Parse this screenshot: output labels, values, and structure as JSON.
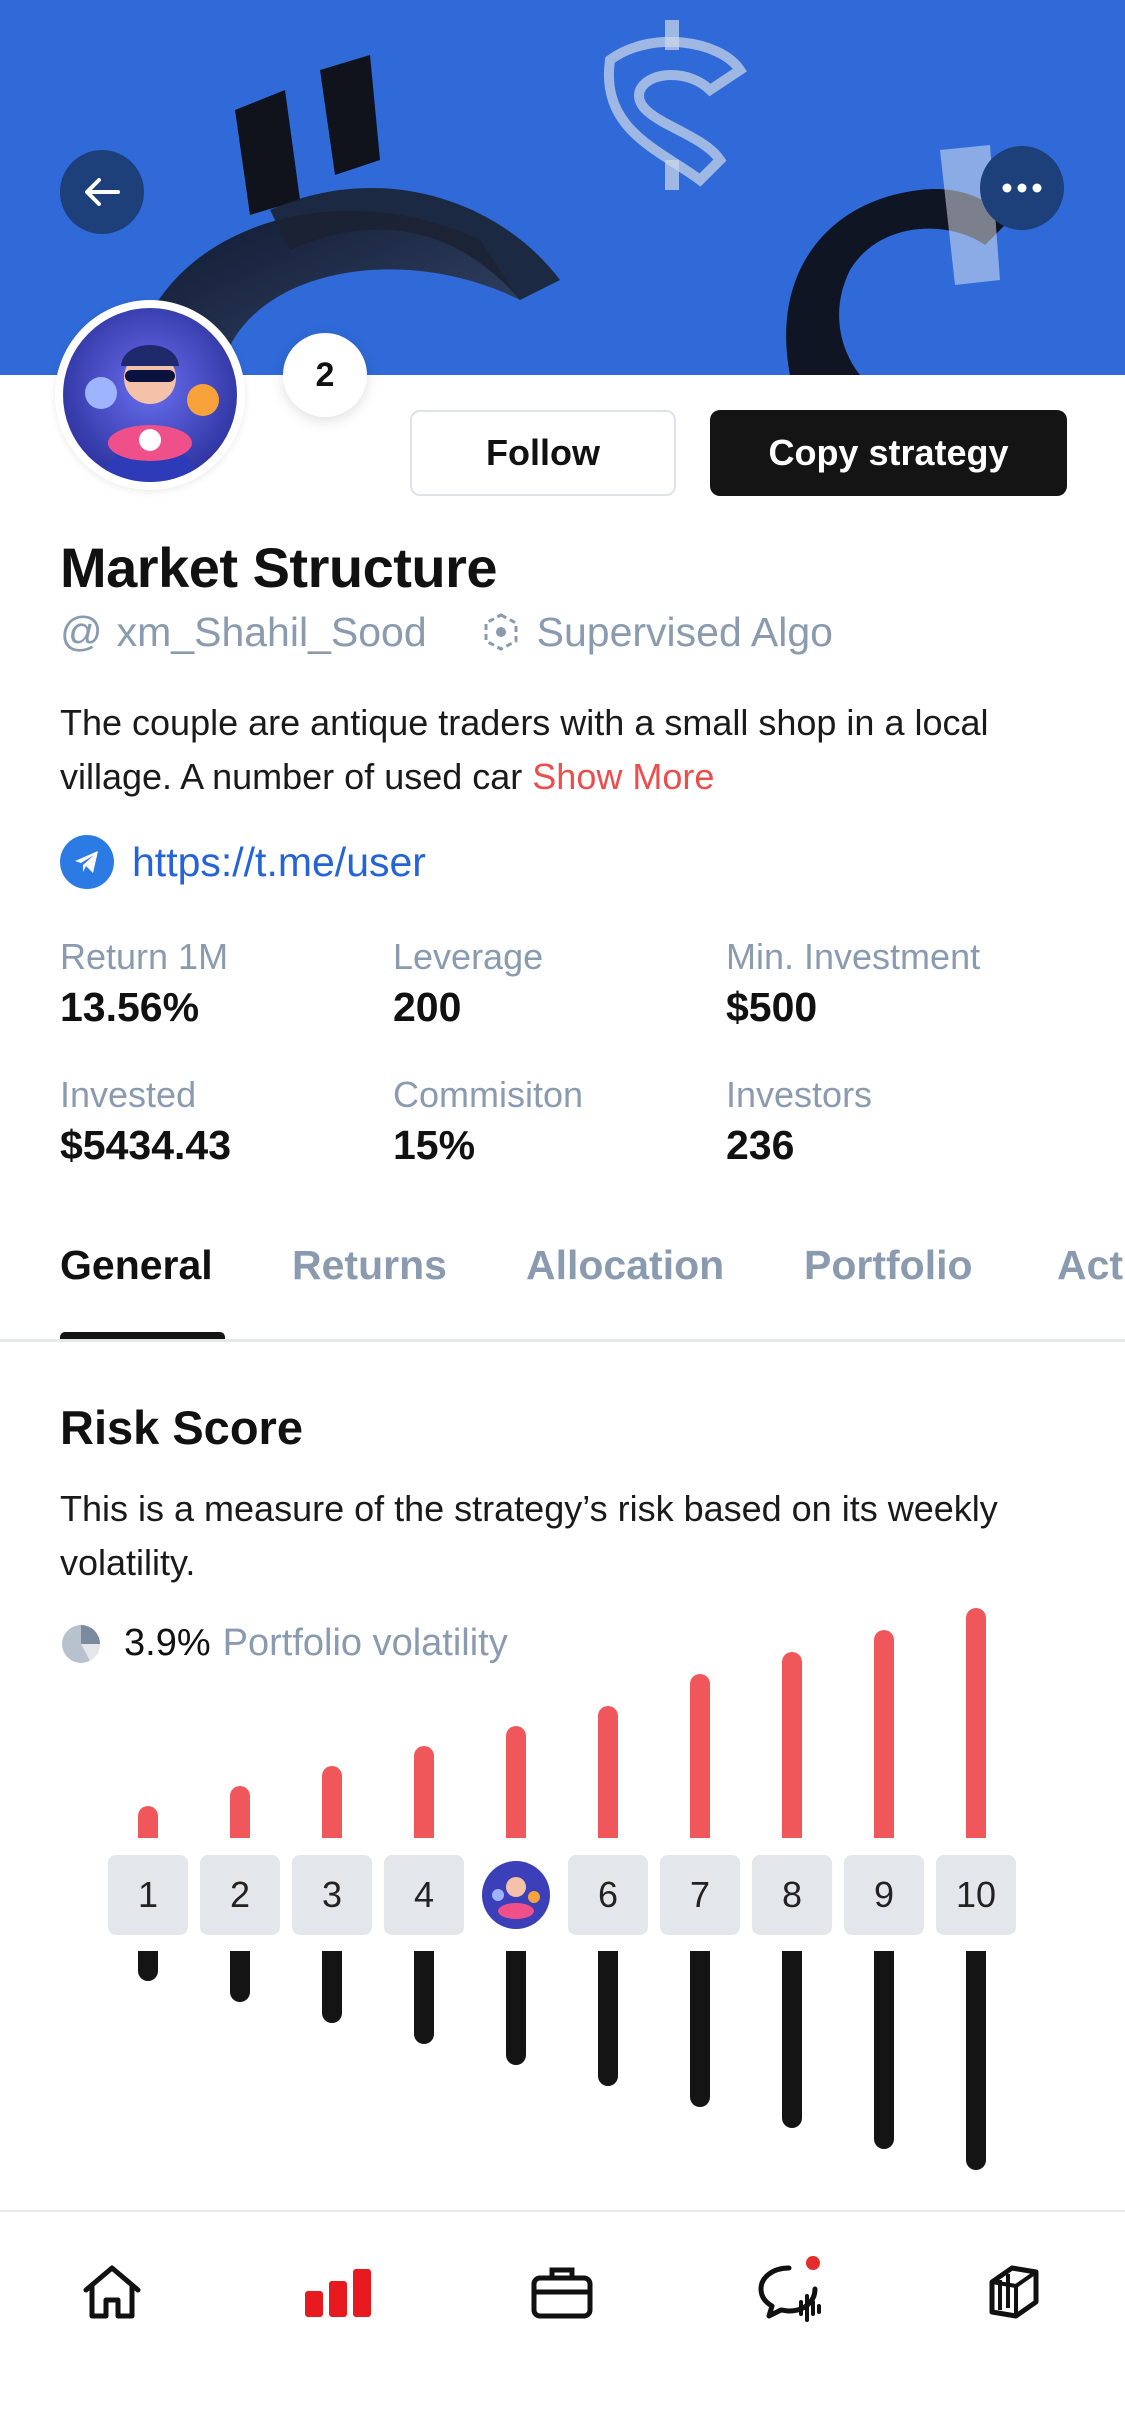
{
  "header": {
    "follower_badge": "2",
    "follow_label": "Follow",
    "copy_label": "Copy strategy"
  },
  "profile": {
    "title": "Market Structure",
    "handle": "xm_Shahil_Sood",
    "type": "Supervised Algo",
    "description": "The couple are antique traders with a small shop in a local village. A number of used car",
    "show_more": "Show More",
    "link": "https://t.me/user"
  },
  "stats": [
    {
      "label": "Return 1M",
      "value": "13.56%"
    },
    {
      "label": "Leverage",
      "value": "200"
    },
    {
      "label": "Min. Investment",
      "value": "$500"
    },
    {
      "label": "Invested",
      "value": "$5434.43"
    },
    {
      "label": "Commisiton",
      "value": "15%"
    },
    {
      "label": "Investors",
      "value": "236"
    }
  ],
  "tabs": [
    "General",
    "Returns",
    "Allocation",
    "Portfolio",
    "Activity"
  ],
  "active_tab": "General",
  "risk": {
    "title": "Risk Score",
    "description": "This is a measure of the strategy’s risk based on its weekly volatility.",
    "volatility_value": "3.9%",
    "volatility_label": "Portfolio volatility",
    "scale": [
      "1",
      "2",
      "3",
      "4",
      "5",
      "6",
      "7",
      "8",
      "9",
      "10"
    ],
    "selected_level": 5
  },
  "colors": {
    "accent_red": "#f0575a",
    "banner_blue": "#2f6ad8",
    "link_blue": "#2563d9",
    "muted": "#8a9bb0"
  },
  "nav": [
    {
      "name": "home-icon"
    },
    {
      "name": "chart-bars-icon",
      "active": true
    },
    {
      "name": "briefcase-icon"
    },
    {
      "name": "chat-icon",
      "notification": true
    },
    {
      "name": "layers-icon"
    }
  ]
}
